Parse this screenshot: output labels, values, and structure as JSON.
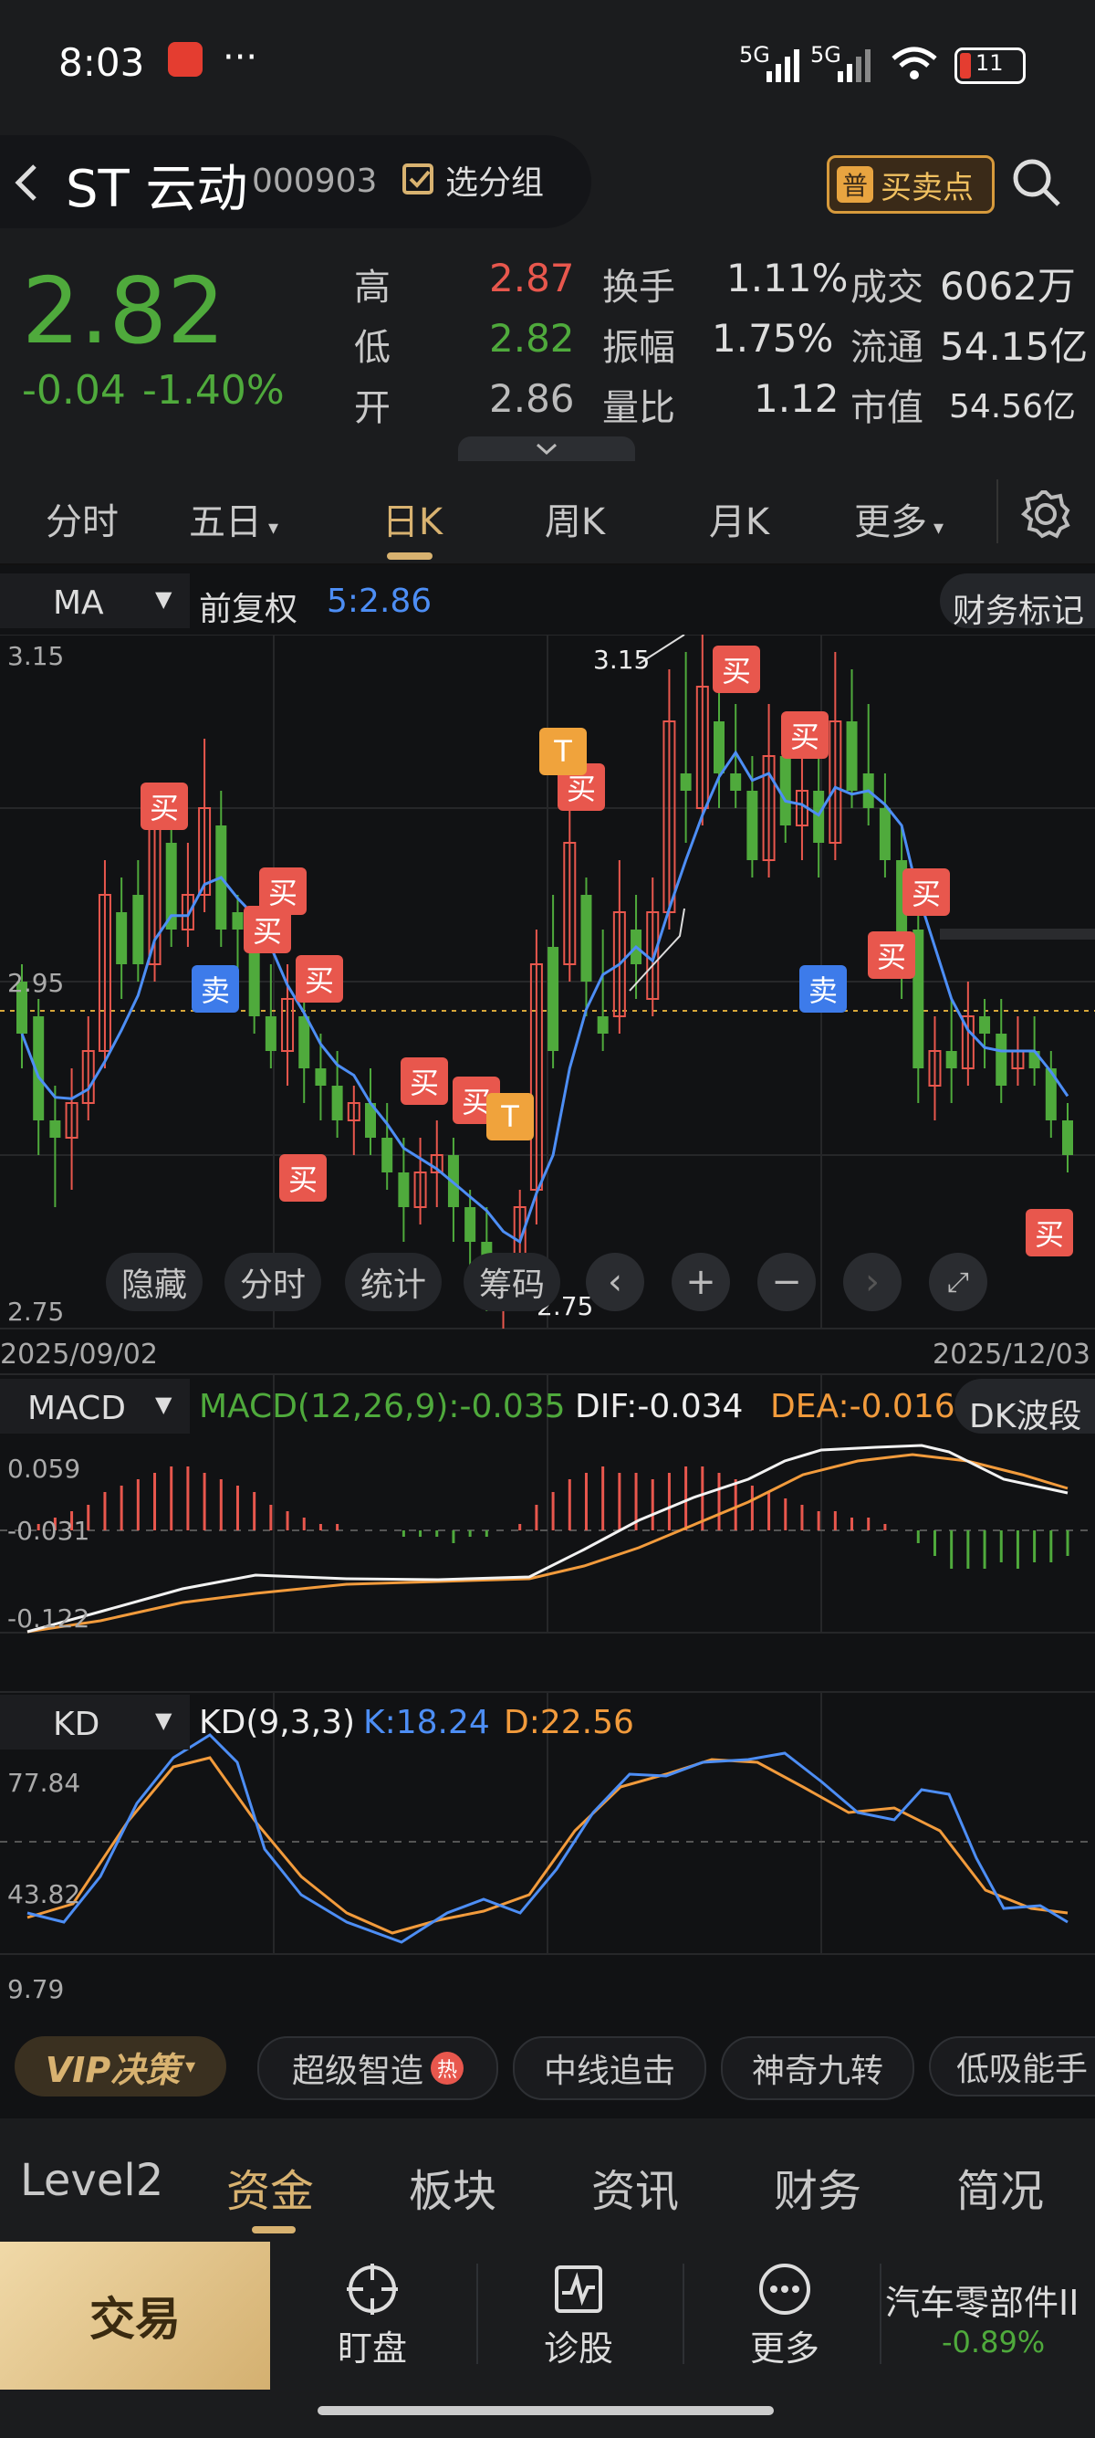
{
  "status": {
    "time": "8:03",
    "dots": "···",
    "net1": "5G",
    "net2": "5G",
    "battery": "11"
  },
  "header": {
    "name": "ST 云动",
    "code": "000903",
    "group_label": "选分组",
    "badge_icon": "普",
    "buy_sell_points": "买卖点"
  },
  "quote": {
    "price": "2.82",
    "change": "-0.04",
    "change_pct": "-1.40%",
    "rows": [
      [
        {
          "label": "高",
          "value": "2.87",
          "color": "red"
        },
        {
          "label": "换手",
          "value": "1.11%"
        },
        {
          "label": "成交",
          "value": "6062万"
        }
      ],
      [
        {
          "label": "低",
          "value": "2.82",
          "color": "green"
        },
        {
          "label": "振幅",
          "value": "1.75%"
        },
        {
          "label": "流通",
          "value": "54.15亿"
        }
      ],
      [
        {
          "label": "开",
          "value": "2.86",
          "color": "gray"
        },
        {
          "label": "量比",
          "value": "1.12"
        },
        {
          "label": "市值",
          "value": "54.56亿"
        }
      ]
    ]
  },
  "period_tabs": [
    "分时",
    "五日",
    "日K",
    "周K",
    "月K",
    "更多"
  ],
  "active_period": "日K",
  "kline": {
    "indicator": "MA",
    "adjust": "前复权",
    "ma_label": "5:2.86",
    "finance_mark": "财务标记",
    "y_top": "3.15",
    "y_mid": "2.95",
    "y_bottom": "2.75",
    "high_label": "3.15",
    "low_label": "2.75",
    "date_start": "2025/09/02",
    "date_end": "2025/12/03",
    "tools": [
      "隐藏",
      "分时",
      "统计",
      "筹码"
    ],
    "signal_buy": "买",
    "signal_sell": "卖",
    "signal_t": "T"
  },
  "macd": {
    "name": "MACD",
    "params": "MACD(12,26,9):-0.035",
    "dif": "DIF:-0.034",
    "dea": "DEA:-0.016",
    "wave": "DK波段",
    "y_top": "0.059",
    "y_mid": "-0.031",
    "y_bottom": "-0.122"
  },
  "kd": {
    "name": "KD",
    "params": "KD(9,3,3)",
    "k": "K:18.24",
    "d": "D:22.56",
    "y_top": "77.84",
    "y_mid": "43.82",
    "y_bottom": "9.79"
  },
  "tools_strip": {
    "vip": "VIP决策",
    "items": [
      "超级智造",
      "中线追击",
      "神奇九转",
      "低吸能手"
    ],
    "hot": "热"
  },
  "bottom_tabs": [
    "Level2",
    "资金",
    "板块",
    "资讯",
    "财务",
    "简况"
  ],
  "active_bottom_tab": "资金",
  "bottom_bar": {
    "trade": "交易",
    "watch": "盯盘",
    "diagnose": "诊股",
    "more": "更多",
    "sector": "汽车零部件II",
    "sector_change": "-0.89%"
  },
  "colors": {
    "up": "#e8574d",
    "down": "#4faa3c",
    "ma": "#4d8ef5",
    "dea": "#f29b3c",
    "gold": "#d8b270"
  }
}
